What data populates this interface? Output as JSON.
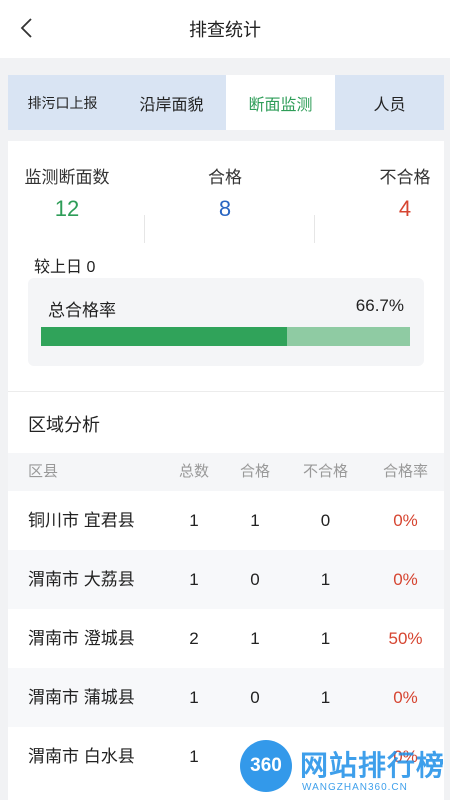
{
  "nav": {
    "title": "排查统计"
  },
  "tabs": [
    {
      "label": "排污口上报"
    },
    {
      "label": "沿岸面貌"
    },
    {
      "label": "断面监测"
    },
    {
      "label": "人员"
    }
  ],
  "stats": {
    "monitored": {
      "label": "监测断面数",
      "value": "12"
    },
    "qualified": {
      "label": "合格",
      "value": "8"
    },
    "unqualified": {
      "label": "不合格",
      "value": "4"
    },
    "compare": "较上日 0"
  },
  "rate": {
    "label": "总合格率",
    "value": "66.7%",
    "fraction": 0.667
  },
  "region": {
    "title": "区域分析",
    "headers": {
      "area": "区县",
      "total": "总数",
      "ok": "合格",
      "bad": "不合格",
      "rate": "合格率"
    },
    "rows": [
      {
        "area": "铜川市  宜君县",
        "total": "1",
        "ok": "1",
        "bad": "0",
        "rate": "0%"
      },
      {
        "area": "渭南市  大荔县",
        "total": "1",
        "ok": "0",
        "bad": "1",
        "rate": "0%"
      },
      {
        "area": "渭南市  澄城县",
        "total": "2",
        "ok": "1",
        "bad": "1",
        "rate": "50%"
      },
      {
        "area": "渭南市  蒲城县",
        "total": "1",
        "ok": "0",
        "bad": "1",
        "rate": "0%"
      },
      {
        "area": "渭南市  白水县",
        "total": "1",
        "ok": "",
        "bad": "",
        "rate": "0%"
      }
    ]
  },
  "watermark": {
    "logo": "360",
    "text": "网站排行榜",
    "sub": "WANGZHAN360.CN"
  },
  "colors": {
    "accent": "#2e9d58",
    "blue": "#2a66c2",
    "red": "#d64531",
    "tab_bg": "#d9e4f3"
  }
}
